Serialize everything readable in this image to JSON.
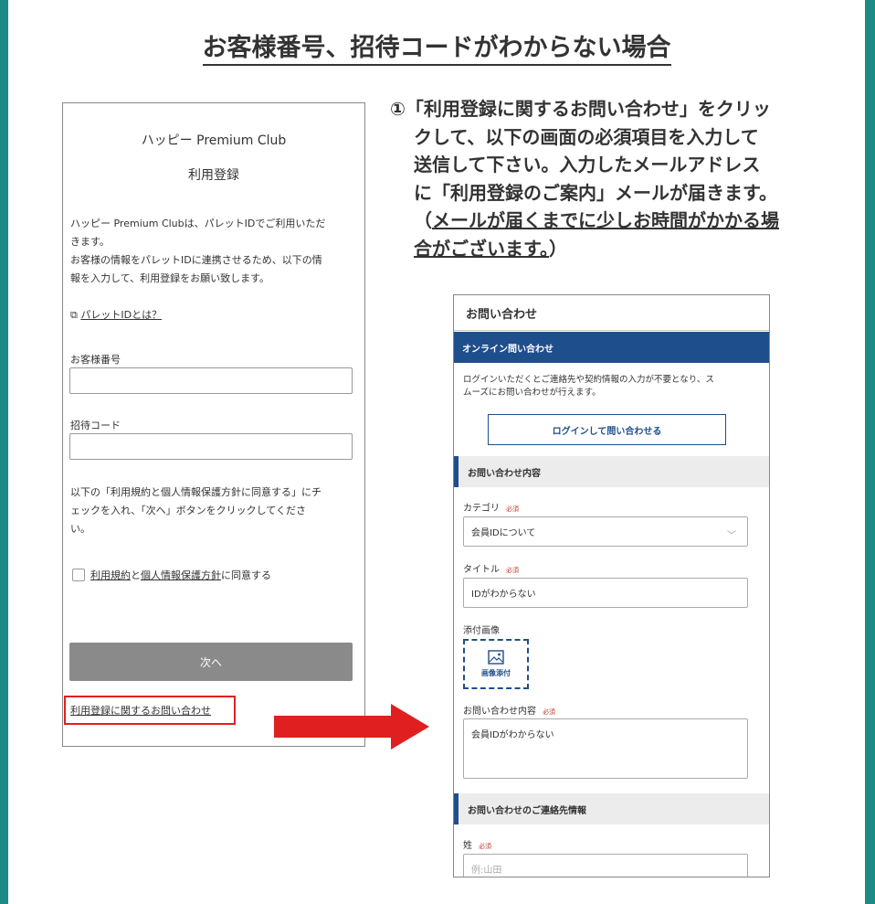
{
  "heading": "お客様番号、招待コードがわからない場合",
  "phone": {
    "app_title": "ハッピー Premium Club",
    "app_subtitle": "利用登録",
    "intro_line1": "ハッピー Premium Clubは、パレットIDでご利用いただ",
    "intro_line2": "きます。",
    "intro_line3": "お客様の情報をパレットIDに連携させるため、以下の情",
    "intro_line4": "報を入力して、利用登録をお願い致します。",
    "about_link": "パレットIDとは？",
    "customer_no_label": "お客様番号",
    "invite_code_label": "招待コード",
    "note_line1": "以下の「利用規約と個人情報保護方針に同意する」にチ",
    "note_line2": "ェックを入れ、「次へ」ボタンをクリックしてくださ",
    "note_line3": "い。",
    "terms_link": "利用規約",
    "and_text": "と",
    "privacy_link": "個人情報保護方針",
    "agree_text": "に同意する",
    "next_button": "次へ",
    "contact_link": "利用登録に関するお問い合わせ"
  },
  "instruction": {
    "line1": "①「利用登録に関するお問い合わせ」をクリッ",
    "line2": "クして、以下の画面の必須項目を入力して",
    "line3": "送信して下さい。入力したメールアドレス",
    "line4": "に「利用登録のご案内」メールが届きます。",
    "line5_open": "（",
    "line5_underlined": "メールが届くまでに少しお時間がかかる場",
    "line6_underlined": "合がございます。",
    "line6_close": "）"
  },
  "form": {
    "title": "お問い合わせ",
    "online_bar": "オンライン問い合わせ",
    "desc_line1": "ログインいただくとご連絡先や契約情報の入力が不要となり、ス",
    "desc_line2": "ムーズにお問い合わせが行えます。",
    "login_button": "ログインして問い合わせる",
    "section1": "お問い合わせ内容",
    "category_label": "カテゴリ",
    "required": "必須",
    "category_value": "会員IDについて",
    "title_label": "タイトル",
    "title_value": "IDがわからない",
    "attach_label": "添付画像",
    "attach_button": "画像添付",
    "content_label": "お問い合わせ内容",
    "content_value": "会員IDがわからない",
    "section2": "お問い合わせのご連絡先情報",
    "surname_label": "姓",
    "surname_placeholder": "例:山田"
  },
  "colors": {
    "frame": "#1d8a86",
    "accent_blue": "#1f4e8c",
    "highlight_red": "#e02020"
  }
}
